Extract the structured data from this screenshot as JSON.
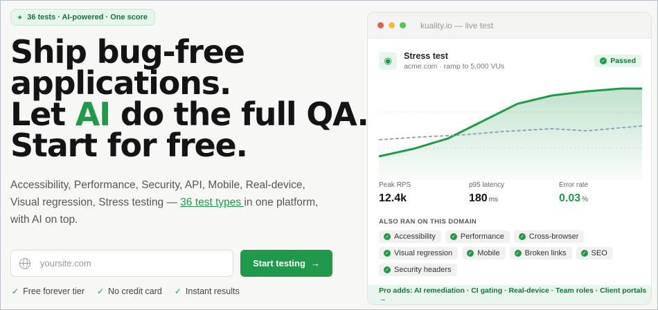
{
  "hero": {
    "badge": "36 tests · AI-powered · One score",
    "headline": {
      "line1": "Ship bug-free",
      "line2": "applications.",
      "line3_pre": "Let ",
      "line3_ai": "AI",
      "line3_post": " do the full QA.",
      "line4": "Start for free."
    },
    "description_pre": "Accessibility, Performance, Security, API, Mobile, Real-device, Visual regression, Stress testing — ",
    "description_link": "36 test types ",
    "description_post": "in one platform, with AI on top.",
    "input_placeholder": "yoursite.com",
    "cta_label": "Start testing",
    "perks": [
      "Free forever tier",
      "No credit card",
      "Instant results"
    ]
  },
  "card": {
    "url": "kuality.io — live test",
    "test_name": "Stress test",
    "test_sub": "acme.com · ramp to 5,000 VUs",
    "status": "Passed",
    "stats": [
      {
        "label": "Peak RPS",
        "value": "12.4k",
        "unit": ""
      },
      {
        "label": "p95 latency",
        "value": "180",
        "unit": "ms"
      },
      {
        "label": "Error rate",
        "value": "0.03",
        "unit": "%"
      }
    ],
    "also_title": "ALSO RAN ON THIS DOMAIN",
    "chips": [
      "Accessibility",
      "Performance",
      "Cross-browser",
      "Visual regression",
      "Mobile",
      "Broken links",
      "SEO",
      "Security headers"
    ],
    "footer": "Pro adds: AI remediation · CI gating · Real-device · Team roles · Client portals →"
  },
  "colors": {
    "accent": "#1f9a4b",
    "accent_bg": "#e7f6ec"
  }
}
